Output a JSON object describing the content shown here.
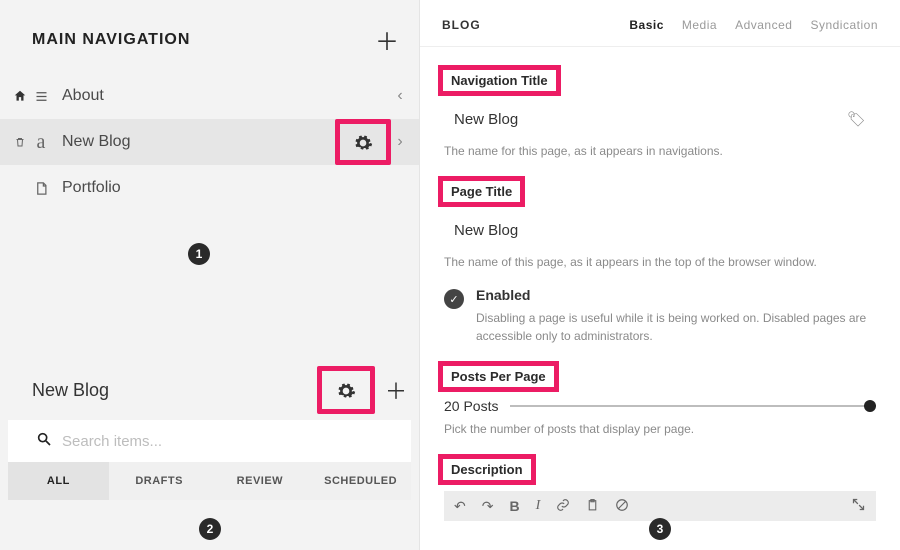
{
  "sidebar": {
    "title": "MAIN NAVIGATION",
    "items": [
      {
        "label": "About"
      },
      {
        "label": "New Blog"
      },
      {
        "label": "Portfolio"
      }
    ]
  },
  "blog_panel": {
    "title": "New Blog",
    "search_placeholder": "Search items...",
    "tabs": [
      "ALL",
      "DRAFTS",
      "REVIEW",
      "SCHEDULED"
    ]
  },
  "steps": {
    "one": "1",
    "two": "2",
    "three": "3"
  },
  "right": {
    "title": "BLOG",
    "tabs": [
      "Basic",
      "Media",
      "Advanced",
      "Syndication"
    ],
    "nav_title": {
      "label": "Navigation Title",
      "value": "New Blog",
      "helper": "The name for this page, as it appears in navigations."
    },
    "page_title": {
      "label": "Page Title",
      "value": "New Blog",
      "helper": "The name of this page, as it appears in the top of the browser window."
    },
    "enabled": {
      "label": "Enabled",
      "helper": "Disabling a page is useful while it is being worked on. Disabled pages are accessible only to administrators."
    },
    "posts_per_page": {
      "label": "Posts Per Page",
      "value": "20 Posts",
      "helper": "Pick the number of posts that display per page."
    },
    "description": {
      "label": "Description"
    }
  }
}
